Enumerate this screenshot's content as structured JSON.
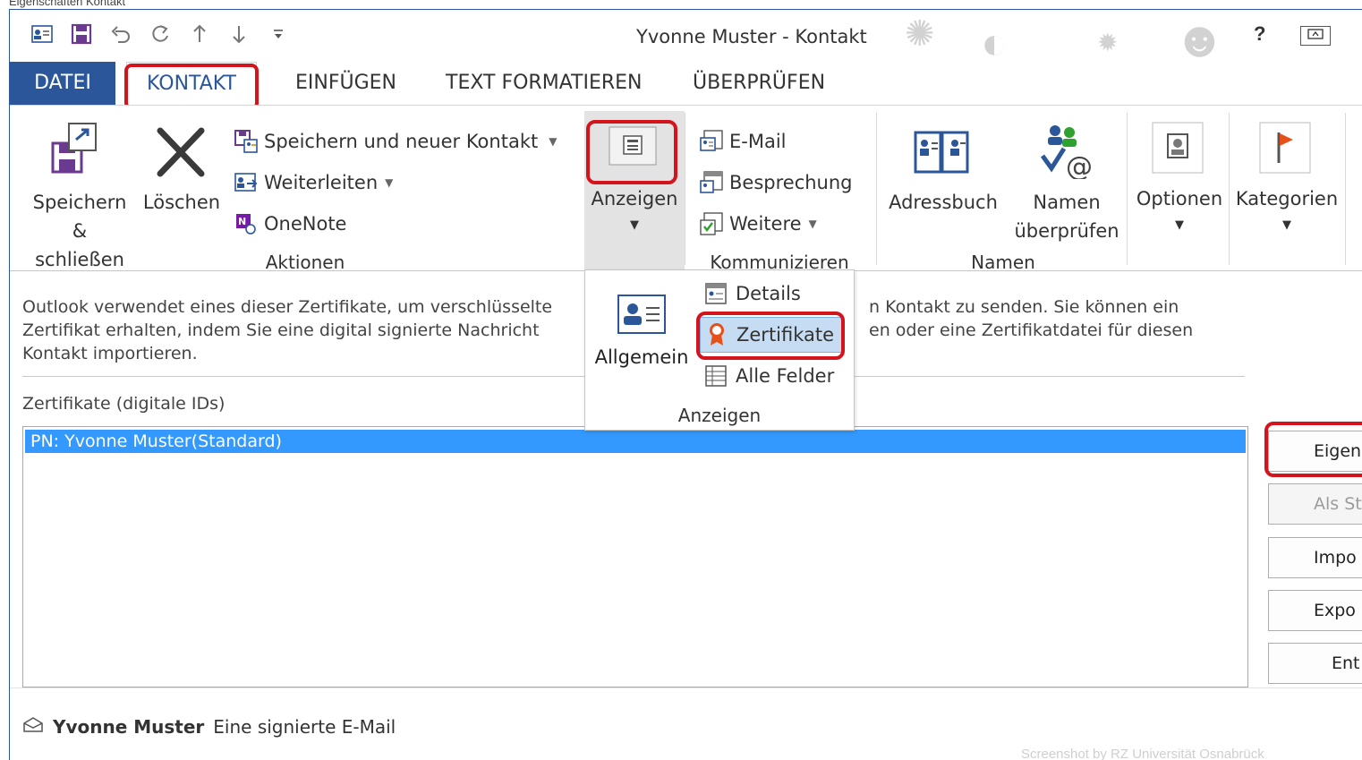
{
  "top_caption": "Eigenschaften Kontakt",
  "window": {
    "title": "Yvonne Muster - Kontakt",
    "help": "?"
  },
  "qat": [
    "contact-card-icon",
    "save-icon",
    "undo-icon",
    "redo-icon",
    "up-arrow-icon",
    "down-arrow-icon",
    "customize-icon"
  ],
  "tabs": [
    "DATEI",
    "KONTAKT",
    "EINFÜGEN",
    "TEXT FORMATIEREN",
    "ÜBERPRÜFEN"
  ],
  "ribbon": {
    "aktionen": {
      "label": "Aktionen",
      "save_close": [
        "Speichern",
        "& schließen"
      ],
      "delete": "Löschen",
      "save_new": "Speichern und neuer Kontakt",
      "forward": "Weiterleiten",
      "onenote": "OneNote"
    },
    "anzeigen": {
      "label": "Anzeigen"
    },
    "kommunizieren": {
      "label": "Kommunizieren",
      "email": "E-Mail",
      "meeting": "Besprechung",
      "more": "Weitere"
    },
    "namen": {
      "label": "Namen",
      "addressbook": "Adressbuch",
      "check": [
        "Namen",
        "überprüfen"
      ]
    },
    "options": "Optionen",
    "categories": "Kategorien"
  },
  "dropdown": {
    "general": "Allgemein",
    "details": "Details",
    "certificates": "Zertifikate",
    "all_fields": "Alle Felder",
    "label": "Anzeigen"
  },
  "content": {
    "info_lines": [
      "Outlook verwendet eines dieser Zertifikate, um verschlüsselte",
      "Zertifikat erhalten, indem Sie eine digital signierte Nachricht",
      "Kontakt importieren."
    ],
    "info_lines_right": [
      "n Kontakt zu senden. Sie können ein",
      "en oder eine Zertifikatdatei für diesen"
    ],
    "cert_label": "Zertifikate (digitale IDs)",
    "cert_rows": [
      "PN: Yvonne Muster(Standard)"
    ],
    "buttons": {
      "properties": "Eigens",
      "default": "Als Star",
      "import": "Impo",
      "export": "Expo",
      "remove": "Ent"
    },
    "footer_name": "Yvonne Muster",
    "footer_text": "Eine signierte E-Mail",
    "watermark": "Screenshot by RZ Universität Osnabrück"
  },
  "colors": {
    "accent": "#2b579a",
    "highlight": "#d4141c",
    "selection": "#3399ff"
  }
}
